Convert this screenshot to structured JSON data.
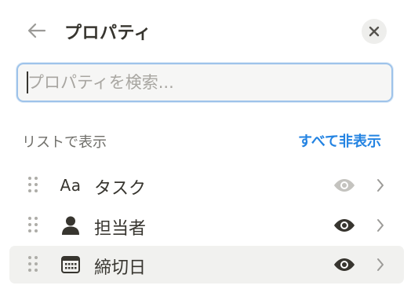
{
  "header": {
    "title": "プロパティ"
  },
  "search": {
    "placeholder": "プロパティを検索..."
  },
  "section": {
    "label": "リストで表示",
    "hide_all": "すべて非表示"
  },
  "properties": [
    {
      "type_icon": "Aa",
      "icon": "text-type-icon",
      "name": "タスク",
      "visible": true,
      "eye_color": "#c4c3bf"
    },
    {
      "type_icon": "person-icon",
      "icon": "person-icon",
      "name": "担当者",
      "visible": true,
      "eye_color": "#37352f"
    },
    {
      "type_icon": "calendar-icon",
      "icon": "calendar-icon",
      "name": "締切日",
      "visible": true,
      "eye_color": "#37352f"
    }
  ],
  "colors": {
    "accent": "#2383e2",
    "text": "#37352f",
    "muted": "#6f6e69",
    "hover_row": "#f1f1ef"
  }
}
